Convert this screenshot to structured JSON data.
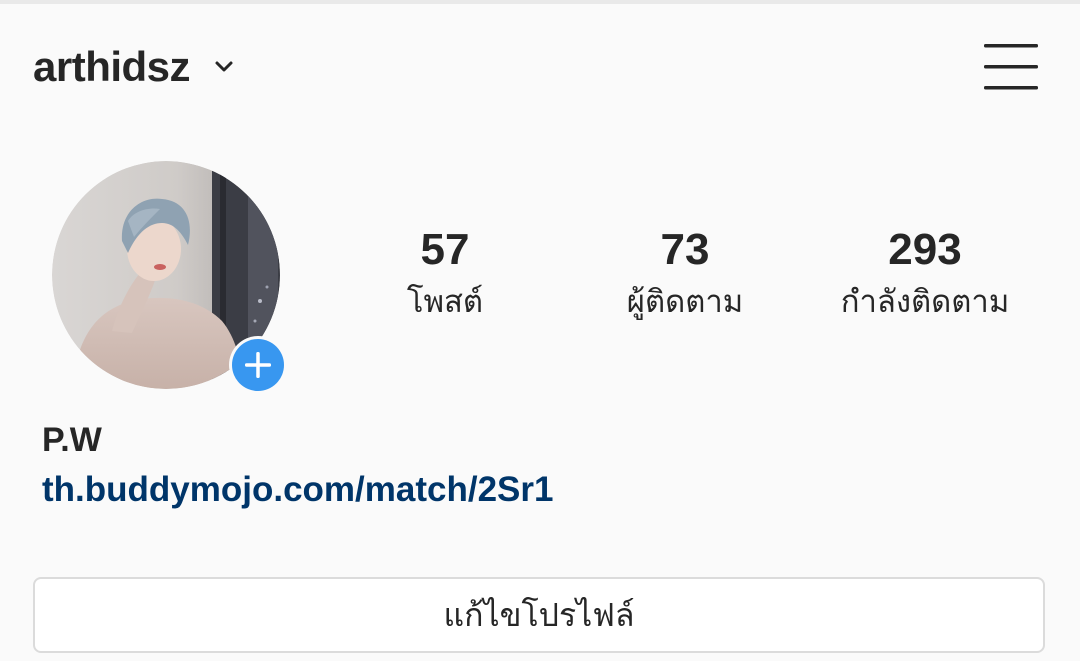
{
  "header": {
    "username": "arthidsz",
    "account_switcher_icon": "chevron-down-icon",
    "menu_icon": "hamburger-menu-icon"
  },
  "profile": {
    "avatar_icon": "profile-photo",
    "add_story_icon": "plus-icon",
    "display_name": "P.W",
    "bio_link": "th.buddymojo.com/match/2Sr1"
  },
  "stats": {
    "posts": {
      "value": "57",
      "label": "โพสต์"
    },
    "followers": {
      "value": "73",
      "label": "ผู้ติดตาม"
    },
    "following": {
      "value": "293",
      "label": "กำลังติดตาม"
    }
  },
  "actions": {
    "edit_profile_label": "แก้ไขโปรไฟล์"
  },
  "colors": {
    "background": "#fafafa",
    "text": "#262626",
    "link": "#003569",
    "accent_blue": "#3897f0",
    "button_border": "#dbdbdb"
  }
}
